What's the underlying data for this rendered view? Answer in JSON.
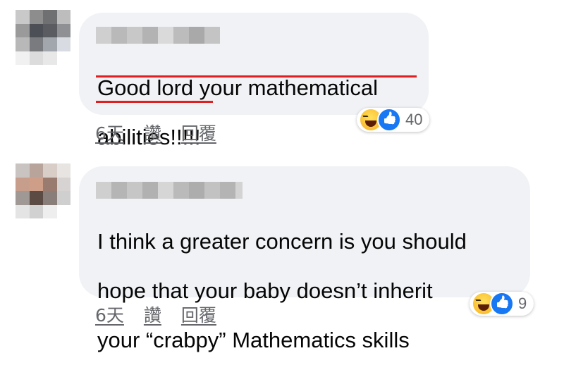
{
  "comments": [
    {
      "text_lines": [
        "Good lord your mathematical",
        "abilities!!!!!"
      ],
      "actions": [
        "6天",
        "讚",
        "回覆"
      ],
      "reactions": {
        "icons": [
          "haha-icon",
          "like-icon"
        ],
        "count": "40"
      }
    },
    {
      "text_lines": [
        "I think a greater concern is you should",
        "hope that your baby doesn’t inherit",
        "your “crabpy” Mathematics skills"
      ],
      "actions": [
        "6天",
        "讚",
        "回覆"
      ],
      "reactions": {
        "icons": [
          "haha-icon",
          "like-icon"
        ],
        "count": "9"
      }
    }
  ],
  "colors": {
    "bubble": "#f0f2f5",
    "underline": "#e02020",
    "like": "#1877f2",
    "meta_text": "#65676b"
  }
}
